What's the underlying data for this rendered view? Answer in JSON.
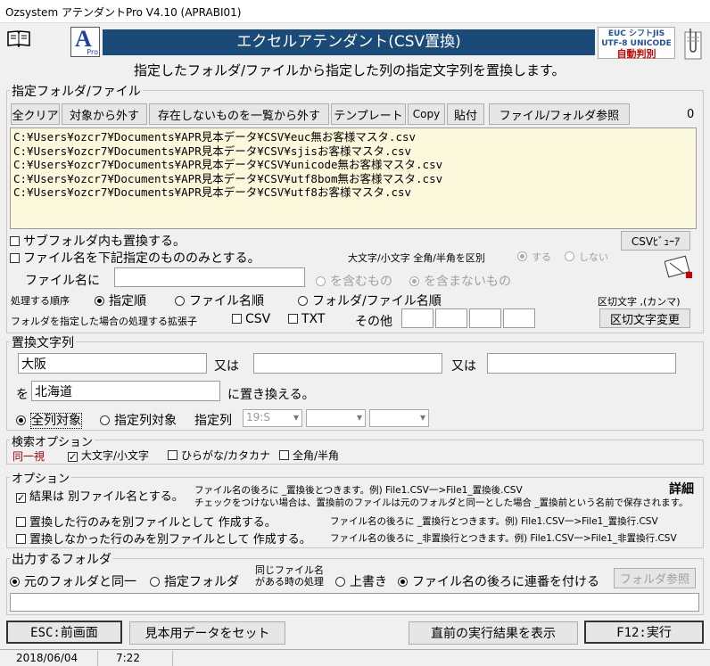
{
  "window": {
    "title": "Ozsystem アテンダントPro V4.10 (APRABI01)"
  },
  "header": {
    "banner": "エクセルアテンダント(CSV置換)",
    "badge_line1": "EUC シフトJIS",
    "badge_line2": "UTF-8 UNICODE",
    "badge_line3": "自動判別",
    "subtitle": "指定したフォルダ/ファイルから指定した列の指定文字列を置換します。",
    "app_logo": "A",
    "app_logo_sub": "Pro"
  },
  "folder_group": {
    "label": "指定フォルダ/ファイル",
    "buttons": [
      "全クリア",
      "対象から外す",
      "存在しないものを一覧から外す",
      "テンプレート",
      "Copy",
      "貼付",
      "ファイル/フォルダ参照"
    ],
    "count": "0",
    "files": [
      "C:¥Users¥ozcr7¥Documents¥APR見本データ¥CSV¥euc無お客様マスタ.csv",
      "C:¥Users¥ozcr7¥Documents¥APR見本データ¥CSV¥sjisお客様マスタ.csv",
      "C:¥Users¥ozcr7¥Documents¥APR見本データ¥CSV¥unicode無お客様マスタ.csv",
      "C:¥Users¥ozcr7¥Documents¥APR見本データ¥CSV¥utf8bom無お客様マスタ.csv",
      "C:¥Users¥ozcr7¥Documents¥APR見本データ¥CSV¥utf8お客様マスタ.csv"
    ],
    "subfolder_label": "サブフォルダ内も置換する。",
    "filename_filter_label": "ファイル名を下記指定のもののみとする。",
    "csv_viewer": "CSVﾋﾞｭｰｱ",
    "case_label": "大文字/小文字 全角/半角を区別",
    "case_yes": "する",
    "case_no": "しない",
    "filename_prefix": "ファイル名に",
    "contains": "を含むもの",
    "not_contains": "を含まないもの",
    "order_label": "処理する順序",
    "order_options": [
      "指定順",
      "ファイル名順",
      "フォルダ/ファイル名順"
    ],
    "delimiter_label": "区切文字 ,(カンマ)",
    "ext_label": "フォルダを指定した場合の処理する拡張子",
    "ext_csv": "CSV",
    "ext_txt": "TXT",
    "ext_other": "その他",
    "delimiter_change": "区切文字変更"
  },
  "replace_group": {
    "label": "置換文字列",
    "search1": "大阪",
    "or1": "又は",
    "search2": "",
    "or2": "又は",
    "search3": "",
    "to_prefix": "を",
    "replacement": "北海道",
    "to_suffix": "に置き換える。",
    "all_columns": "全列対象",
    "specific_columns": "指定列対象",
    "col_label": "指定列",
    "col_value": "19:S"
  },
  "search_options": {
    "label": "検索オプション",
    "same": "同一視",
    "case": "大文字/小文字",
    "kana": "ひらがな/カタカナ",
    "width": "全角/半角"
  },
  "options": {
    "label": "オプション",
    "detail": "詳細",
    "separate_file": "結果は 別ファイル名とする。",
    "separate_note1": "ファイル名の後ろに _置換後とつきます。例) File1.CSV一>File1_置換後.CSV",
    "separate_note2": "チェックをつけない場合は、置換前のファイルは元のフォルダと同一とした場合 _置換前という名前で保存されます。",
    "replaced_only": "置換した行のみを別ファイルとして 作成する。",
    "replaced_note": "ファイル名の後ろに _置換行とつきます。例) File1.CSV一>File1_置換行.CSV",
    "not_replaced": "置換しなかった行のみを別ファイルとして 作成する。",
    "not_replaced_note": "ファイル名の後ろに _非置換行とつきます。例) File1.CSV一>File1_非置換行.CSV"
  },
  "output": {
    "label": "出力するフォルダ",
    "same_folder": "元のフォルダと同一",
    "specified": "指定フォルダ",
    "same_name_line1": "同じファイル名",
    "same_name_line2": "がある時の処理",
    "overwrite": "上書き",
    "serial": "ファイル名の後ろに連番を付ける",
    "browse": "フォルダ参照",
    "path": ""
  },
  "footer": {
    "esc": "ESC:前画面",
    "sample": "見本用データをセット",
    "last_result": "直前の実行結果を表示",
    "run": "F12:実行"
  },
  "status": {
    "date": "2018/06/04",
    "time": "7:22"
  },
  "colors": {
    "banner": "#1a4a78",
    "filebox": "#fcf8dc",
    "logo": "#1c3fa8"
  }
}
